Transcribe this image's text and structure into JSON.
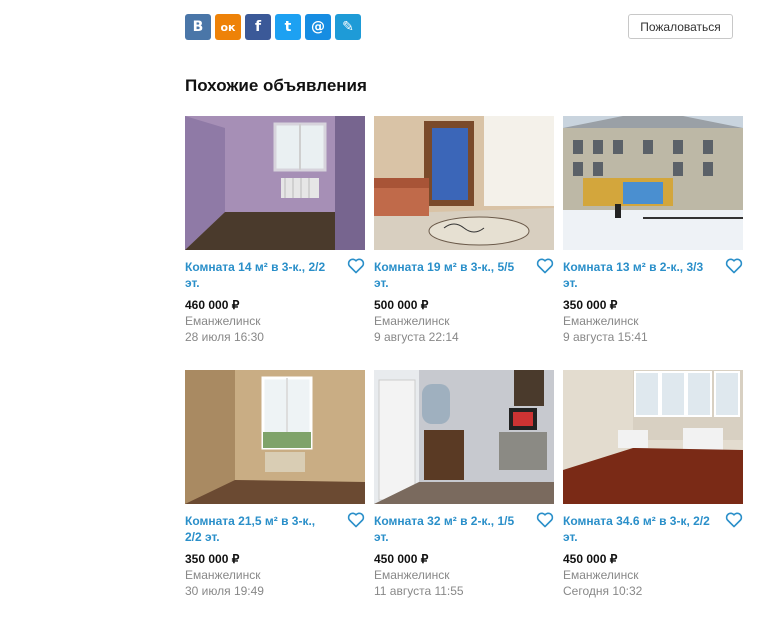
{
  "share": {
    "buttons": [
      {
        "name": "vk-share-button",
        "label": "B",
        "color": "#4a76a8"
      },
      {
        "name": "ok-share-button",
        "label": "ок",
        "color": "#ee8208"
      },
      {
        "name": "facebook-share-button",
        "label": "f",
        "color": "#3b5998"
      },
      {
        "name": "twitter-share-button",
        "label": "t",
        "color": "#1da1f2"
      },
      {
        "name": "mailru-share-button",
        "label": "@",
        "color": "#168de2"
      },
      {
        "name": "livejournal-share-button",
        "label": "✎",
        "color": "#1e9bd7"
      }
    ]
  },
  "complain_label": "Пожаловаться",
  "section_title": "Похожие объявления",
  "favorite_icon": "heart-outline-icon",
  "colors": {
    "link": "#2a8fc9",
    "muted": "#888888"
  },
  "listings": [
    {
      "title": "Комната 14 м² в 3-к., 2/2 эт.",
      "price": "460 000 ₽",
      "city": "Еманжелинск",
      "date": "28 июля 16:30"
    },
    {
      "title": "Комната 19 м² в 3-к., 5/5 эт.",
      "price": "500 000 ₽",
      "city": "Еманжелинск",
      "date": "9 августа 22:14"
    },
    {
      "title": "Комната 13 м² в 2-к., 3/3 эт.",
      "price": "350 000 ₽",
      "city": "Еманжелинск",
      "date": "9 августа 15:41"
    },
    {
      "title": "Комната 21,5 м² в 3-к., 2/2 эт.",
      "price": "350 000 ₽",
      "city": "Еманжелинск",
      "date": "30 июля 19:49"
    },
    {
      "title": "Комната 32 м² в 2-к., 1/5 эт.",
      "price": "450 000 ₽",
      "city": "Еманжелинск",
      "date": "11 августа 11:55"
    },
    {
      "title": "Комната 34.6 м² в 3-к, 2/2 эт.",
      "price": "450 000 ₽",
      "city": "Еманжелинск",
      "date": "Сегодня 10:32"
    }
  ]
}
